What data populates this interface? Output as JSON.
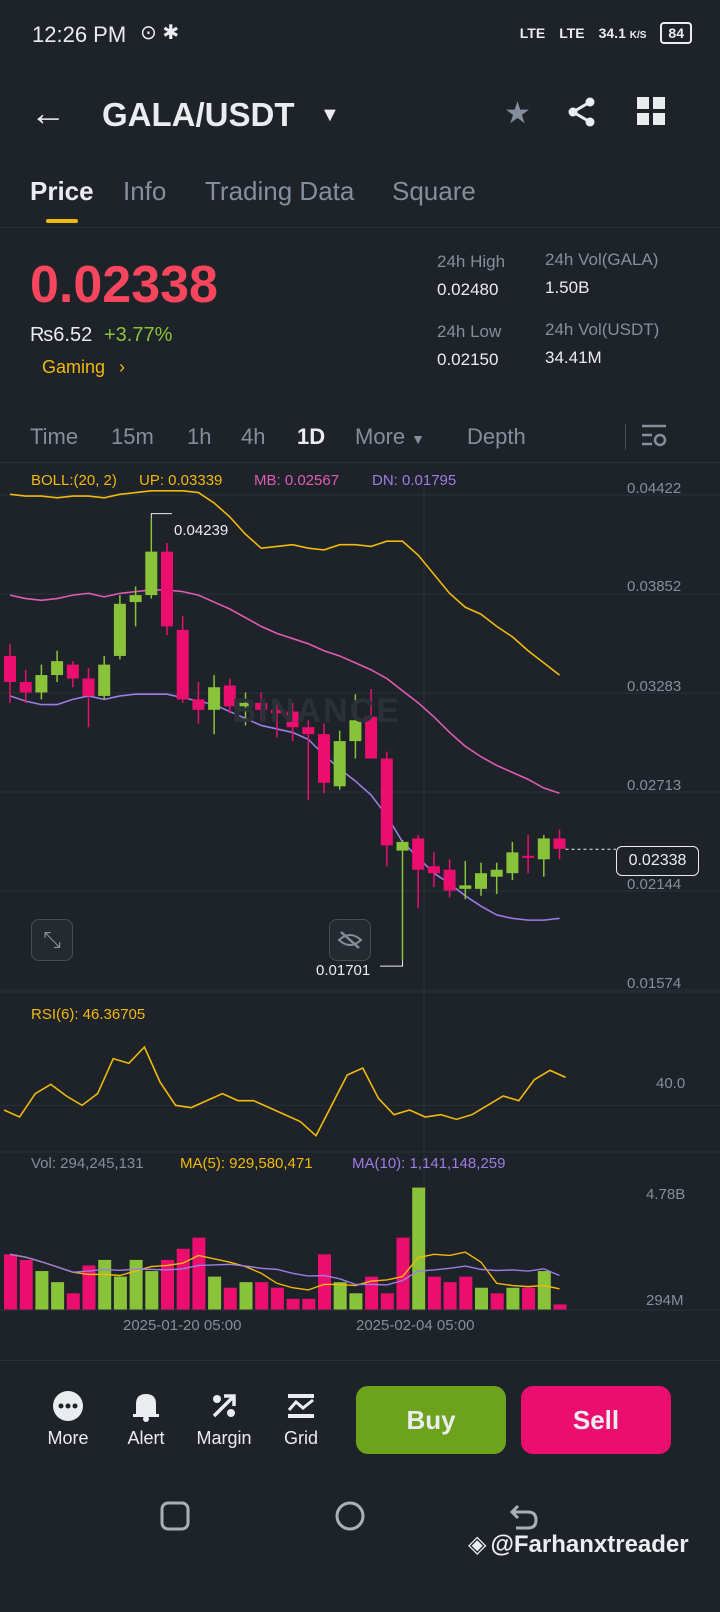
{
  "status": {
    "time": "12:26 PM",
    "network_1": "LTE",
    "network_2": "LTE",
    "speed": "34.1",
    "speed_unit": "K/S",
    "battery": "84"
  },
  "header": {
    "pair": "GALA/USDT",
    "icons": [
      "back-arrow-icon",
      "chevron-down-icon",
      "star-icon",
      "share-icon",
      "grid-icon"
    ]
  },
  "tabs": [
    {
      "label": "Price",
      "active": true
    },
    {
      "label": "Info",
      "active": false
    },
    {
      "label": "Trading Data",
      "active": false
    },
    {
      "label": "Square",
      "active": false
    }
  ],
  "ticker": {
    "price": "0.02338",
    "fiat": "₨6.52",
    "change": "+3.77%",
    "category": "Gaming",
    "high_label": "24h High",
    "high": "0.02480",
    "low_label": "24h Low",
    "low": "0.02150",
    "vol_gala_label": "24h Vol(GALA)",
    "vol_gala": "1.50B",
    "vol_usdt_label": "24h Vol(USDT)",
    "vol_usdt": "34.41M"
  },
  "timeframes": [
    {
      "label": "Time",
      "active": false
    },
    {
      "label": "15m",
      "active": false
    },
    {
      "label": "1h",
      "active": false
    },
    {
      "label": "4h",
      "active": false
    },
    {
      "label": "1D",
      "active": true
    },
    {
      "label": "More",
      "active": false
    },
    {
      "label": "Depth",
      "active": false
    }
  ],
  "indicators": {
    "boll_name": "BOLL:(20, 2)",
    "boll_up": "UP: 0.03339",
    "boll_mb": "MB: 0.02567",
    "boll_dn": "DN: 0.01795",
    "rsi": "RSI(6): 46.36705",
    "vol": "Vol: 294,245,131",
    "ma5": "MA(5): 929,580,471",
    "ma10": "MA(10): 1,141,148,259"
  },
  "colors": {
    "up": "#89c33a",
    "down": "#eb0e6f",
    "boll_up": "#f0b90b",
    "boll_mb": "#e05bb4",
    "boll_dn": "#9d7ce3",
    "accent": "#f0b90b"
  },
  "chart_data": {
    "type": "candlestick",
    "price_axis": [
      "0.04422",
      "0.03852",
      "0.03283",
      "0.02713",
      "0.02144",
      "0.01574"
    ],
    "price_ylim": [
      0.01574,
      0.04422
    ],
    "high_marker": "0.04239",
    "low_marker": "0.01701",
    "current_price": "0.02338",
    "rsi_axis": "40.0",
    "vol_axis_top": "4.78B",
    "vol_axis_bottom": "294M",
    "x_labels": [
      "2025-01-20 05:00",
      "2025-02-04 05:00"
    ],
    "candles": [
      {
        "o": 0.0345,
        "h": 0.0352,
        "l": 0.0318,
        "c": 0.033
      },
      {
        "o": 0.033,
        "h": 0.0337,
        "l": 0.0318,
        "c": 0.0324
      },
      {
        "o": 0.0324,
        "h": 0.034,
        "l": 0.032,
        "c": 0.0334
      },
      {
        "o": 0.0334,
        "h": 0.0348,
        "l": 0.033,
        "c": 0.0342
      },
      {
        "o": 0.034,
        "h": 0.0342,
        "l": 0.0327,
        "c": 0.0332
      },
      {
        "o": 0.0332,
        "h": 0.0338,
        "l": 0.0304,
        "c": 0.0322
      },
      {
        "o": 0.0322,
        "h": 0.0345,
        "l": 0.032,
        "c": 0.034
      },
      {
        "o": 0.0345,
        "h": 0.038,
        "l": 0.0343,
        "c": 0.0375
      },
      {
        "o": 0.0376,
        "h": 0.0385,
        "l": 0.0362,
        "c": 0.038
      },
      {
        "o": 0.038,
        "h": 0.0424,
        "l": 0.0378,
        "c": 0.0405
      },
      {
        "o": 0.0405,
        "h": 0.041,
        "l": 0.0357,
        "c": 0.0362
      },
      {
        "o": 0.036,
        "h": 0.0368,
        "l": 0.0318,
        "c": 0.032
      },
      {
        "o": 0.032,
        "h": 0.033,
        "l": 0.0306,
        "c": 0.0314
      },
      {
        "o": 0.0314,
        "h": 0.0334,
        "l": 0.03,
        "c": 0.0327
      },
      {
        "o": 0.0328,
        "h": 0.0332,
        "l": 0.0312,
        "c": 0.0316
      },
      {
        "o": 0.0316,
        "h": 0.0324,
        "l": 0.0305,
        "c": 0.0318
      },
      {
        "o": 0.0318,
        "h": 0.0324,
        "l": 0.0308,
        "c": 0.0314
      },
      {
        "o": 0.0314,
        "h": 0.032,
        "l": 0.0298,
        "c": 0.0312
      },
      {
        "o": 0.0313,
        "h": 0.0318,
        "l": 0.0296,
        "c": 0.0304
      },
      {
        "o": 0.0304,
        "h": 0.0308,
        "l": 0.0262,
        "c": 0.03
      },
      {
        "o": 0.03,
        "h": 0.0306,
        "l": 0.0266,
        "c": 0.0272
      },
      {
        "o": 0.027,
        "h": 0.0302,
        "l": 0.0268,
        "c": 0.0296
      },
      {
        "o": 0.0296,
        "h": 0.0323,
        "l": 0.0286,
        "c": 0.0308
      },
      {
        "o": 0.031,
        "h": 0.0326,
        "l": 0.0304,
        "c": 0.0286
      },
      {
        "o": 0.0286,
        "h": 0.029,
        "l": 0.0224,
        "c": 0.0236
      },
      {
        "o": 0.0233,
        "h": 0.0239,
        "l": 0.017,
        "c": 0.0238
      },
      {
        "o": 0.024,
        "h": 0.0242,
        "l": 0.02,
        "c": 0.0222
      },
      {
        "o": 0.0224,
        "h": 0.0232,
        "l": 0.0212,
        "c": 0.022
      },
      {
        "o": 0.0222,
        "h": 0.0228,
        "l": 0.0206,
        "c": 0.021
      },
      {
        "o": 0.0211,
        "h": 0.0227,
        "l": 0.0205,
        "c": 0.0213
      },
      {
        "o": 0.0211,
        "h": 0.0226,
        "l": 0.0207,
        "c": 0.022
      },
      {
        "o": 0.0218,
        "h": 0.0226,
        "l": 0.0208,
        "c": 0.0222
      },
      {
        "o": 0.022,
        "h": 0.0238,
        "l": 0.0216,
        "c": 0.0232
      },
      {
        "o": 0.023,
        "h": 0.0242,
        "l": 0.022,
        "c": 0.0229
      },
      {
        "o": 0.0228,
        "h": 0.0242,
        "l": 0.0218,
        "c": 0.024
      },
      {
        "o": 0.024,
        "h": 0.0245,
        "l": 0.0228,
        "c": 0.0234
      }
    ],
    "boll_up_line": [
      0.0438,
      0.0437,
      0.0437,
      0.0436,
      0.0437,
      0.0437,
      0.0436,
      0.0438,
      0.0439,
      0.044,
      0.044,
      0.044,
      0.0439,
      0.0433,
      0.0425,
      0.0415,
      0.0407,
      0.0408,
      0.0409,
      0.0407,
      0.0406,
      0.0409,
      0.0409,
      0.0408,
      0.0411,
      0.0411,
      0.0403,
      0.0392,
      0.0381,
      0.0373,
      0.0369,
      0.0362,
      0.0356,
      0.0348,
      0.0341,
      0.0334
    ],
    "boll_mb_line": [
      0.038,
      0.0378,
      0.0377,
      0.0378,
      0.038,
      0.0381,
      0.0379,
      0.0381,
      0.0382,
      0.0383,
      0.0383,
      0.0382,
      0.038,
      0.0376,
      0.0372,
      0.0367,
      0.0362,
      0.0358,
      0.0355,
      0.0352,
      0.0348,
      0.0345,
      0.0341,
      0.0337,
      0.0332,
      0.0325,
      0.0318,
      0.031,
      0.0301,
      0.0293,
      0.0287,
      0.0282,
      0.0278,
      0.0274,
      0.0269,
      0.0266
    ],
    "boll_dn_line": [
      0.0322,
      0.0319,
      0.0317,
      0.0317,
      0.032,
      0.0322,
      0.032,
      0.0322,
      0.0323,
      0.0323,
      0.0323,
      0.0321,
      0.0319,
      0.0317,
      0.0313,
      0.0309,
      0.0305,
      0.0303,
      0.0301,
      0.0297,
      0.0288,
      0.028,
      0.0273,
      0.0265,
      0.0253,
      0.0238,
      0.0229,
      0.022,
      0.0214,
      0.0207,
      0.0201,
      0.0196,
      0.0194,
      0.0193,
      0.0193,
      0.0194
    ],
    "rsi_ylim": [
      20,
      80
    ],
    "rsi_values": [
      38,
      35,
      45,
      49,
      44,
      40,
      45,
      60,
      58,
      65,
      50,
      40,
      39,
      42,
      45,
      42,
      42,
      39,
      36,
      33,
      27,
      40,
      53,
      56,
      43,
      36,
      38,
      35,
      36,
      34,
      36,
      40,
      44,
      42,
      51,
      55,
      52
    ],
    "volumes": [
      1.0,
      0.9,
      0.7,
      0.5,
      0.3,
      0.8,
      0.9,
      0.6,
      0.9,
      0.7,
      0.9,
      1.1,
      1.3,
      0.6,
      0.4,
      0.5,
      0.5,
      0.4,
      0.2,
      0.2,
      1.0,
      0.5,
      0.3,
      0.6,
      0.3,
      1.3,
      2.2,
      0.6,
      0.5,
      0.6,
      0.4,
      0.3,
      0.4,
      0.4,
      0.7,
      0.1
    ],
    "vol_up": [
      false,
      false,
      true,
      true,
      false,
      false,
      true,
      true,
      true,
      true,
      false,
      false,
      false,
      true,
      false,
      true,
      false,
      false,
      false,
      false,
      false,
      true,
      true,
      false,
      false,
      false,
      true,
      false,
      false,
      false,
      true,
      false,
      true,
      false,
      true,
      false
    ],
    "vol_ylim": [
      0,
      2.3
    ]
  },
  "toolbar": {
    "more": "More",
    "alert": "Alert",
    "margin": "Margin",
    "grid": "Grid",
    "buy": "Buy",
    "sell": "Sell"
  },
  "watermark": "@Farhanxtreader",
  "chart_watermark": "BINANCE"
}
